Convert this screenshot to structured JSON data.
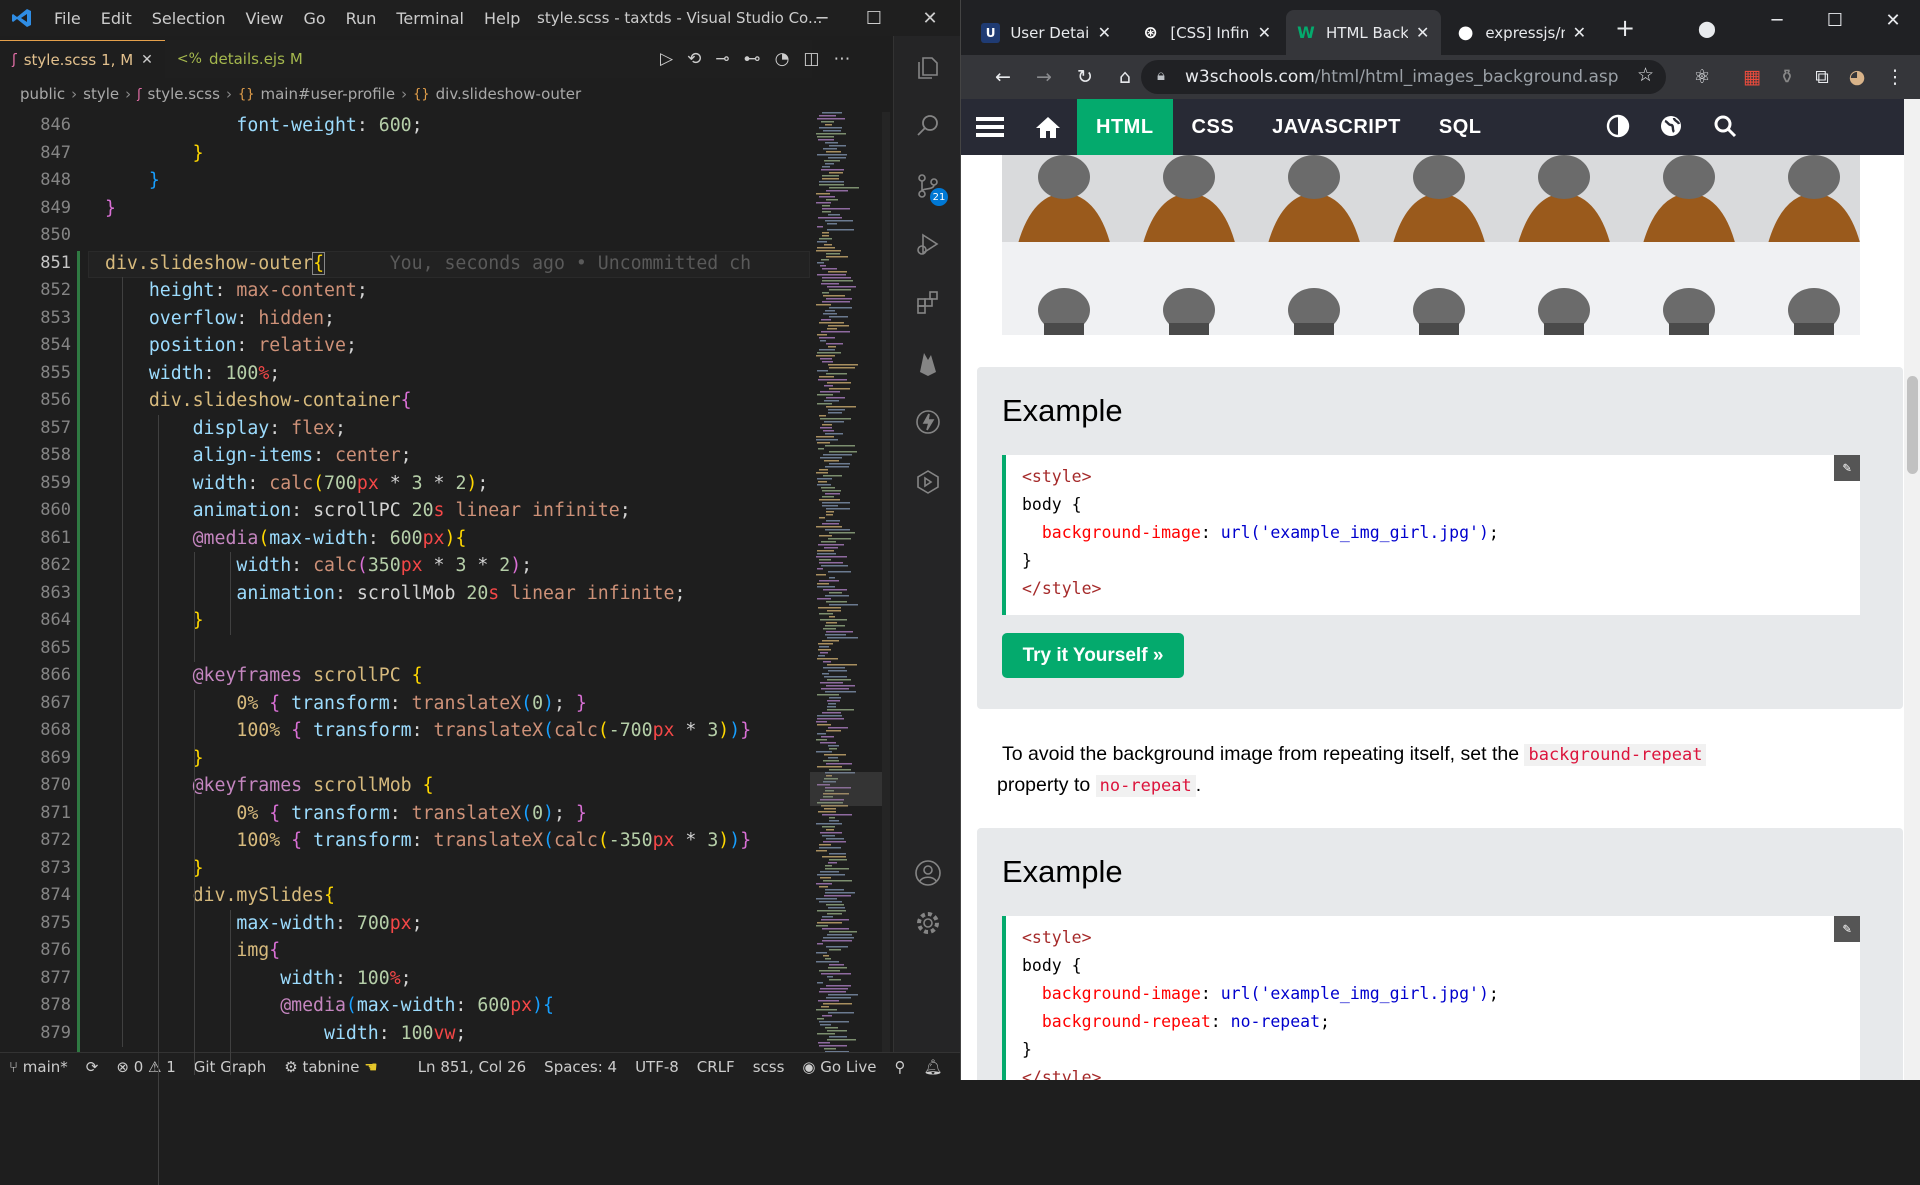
{
  "vscode": {
    "menu": [
      "File",
      "Edit",
      "Selection",
      "View",
      "Go",
      "Run",
      "Terminal",
      "Help"
    ],
    "window_title": "style.scss - taxtds - Visual Studio Co...",
    "tabs": [
      {
        "label": "style.scss",
        "status": "1, M",
        "active": true
      },
      {
        "label": "details.ejs",
        "status": "M",
        "active": false
      }
    ],
    "breadcrumb": [
      "public",
      "style",
      "style.scss",
      "main#user-profile",
      "div.slideshow-outer"
    ],
    "line_numbers": [
      "846",
      "847",
      "848",
      "849",
      "850",
      "851",
      "852",
      "853",
      "854",
      "855",
      "856",
      "857",
      "858",
      "859",
      "860",
      "861",
      "862",
      "863",
      "864",
      "865",
      "866",
      "867",
      "868",
      "869",
      "870",
      "871",
      "872",
      "873",
      "874",
      "875",
      "876",
      "877",
      "878",
      "879"
    ],
    "current_line": "851",
    "blame_text": "You, seconds ago • Uncommitted ch",
    "code_lines": [
      "            font-weight: 600;",
      "        }",
      "    }",
      "}",
      "",
      "div.slideshow-outer{",
      "    height: max-content;",
      "    overflow: hidden;",
      "    position: relative;",
      "    width: 100%;",
      "    div.slideshow-container{",
      "        display: flex;",
      "        align-items: center;",
      "        width: calc(700px * 3 * 2);",
      "        animation: scrollPC 20s linear infinite;",
      "        @media(max-width: 600px){",
      "            width: calc(350px * 3 * 2);",
      "            animation: scrollMob 20s linear infinite;",
      "        }",
      "",
      "        @keyframes scrollPC {",
      "            0% { transform: translateX(0); }",
      "            100% { transform: translateX(calc(-700px * 3))}",
      "        }",
      "        @keyframes scrollMob {",
      "            0% { transform: translateX(0); }",
      "            100% { transform: translateX(calc(-350px * 3))}",
      "        }",
      "        div.mySlides{",
      "            max-width: 700px;",
      "            img{",
      "                width: 100%;",
      "                @media(max-width: 600px){",
      "                    width: 100vw;"
    ],
    "scm_badge": "21",
    "status": {
      "branch": "main*",
      "errors": "0",
      "warnings": "1",
      "git_graph": "Git Graph",
      "tabnine": "tabnine",
      "position": "Ln 851, Col 26",
      "spaces": "Spaces: 4",
      "encoding": "UTF-8",
      "eol": "CRLF",
      "language": "scss",
      "golive": "Go Live"
    }
  },
  "chrome": {
    "tabs": [
      {
        "title": "User Details",
        "favicon": "U",
        "favicon_color": "#1565c0"
      },
      {
        "title": "[CSS] Infinite",
        "favicon": "⊛",
        "favicon_color": "#ffffff"
      },
      {
        "title": "HTML Background",
        "favicon": "W",
        "favicon_color": "#04AA6D"
      },
      {
        "title": "expressjs/multer",
        "favicon": "●",
        "favicon_color": "#ffffff"
      }
    ],
    "url_domain": "w3schools.com",
    "url_path": "/html/html_images_background.asp"
  },
  "w3": {
    "nav": [
      "HTML",
      "CSS",
      "JAVASCRIPT",
      "SQL"
    ],
    "example_heading": "Example",
    "example1_code": [
      "<style>",
      "body {",
      "  background-image: url('example_img_girl.jpg');",
      "}",
      "</style>"
    ],
    "try_button": "Try it Yourself »",
    "text_before": "To avoid the background image from repeating itself, set the ",
    "code_prop": "background-repeat",
    "text_mid": " property to ",
    "code_val": "no-repeat",
    "text_end": ".",
    "example2_code": [
      "<style>",
      "body {",
      "  background-image: url('example_img_girl.jpg');",
      "  background-repeat: no-repeat;",
      "}",
      "</style>"
    ]
  },
  "colors": {
    "w3_green": "#04AA6D",
    "w3_nav": "#282A35",
    "vs_bg": "#1e1e1e"
  }
}
